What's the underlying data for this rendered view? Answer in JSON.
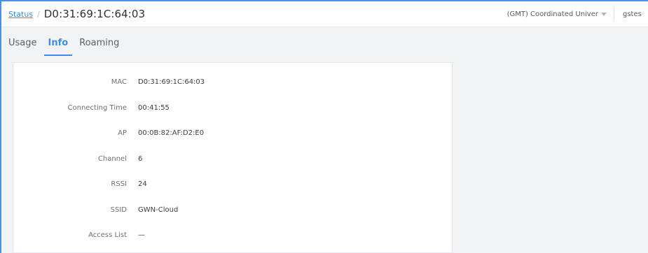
{
  "header": {
    "breadcrumb_link": "Status",
    "breadcrumb_sep": "/",
    "title": "D0:31:69:1C:64:03",
    "timezone": "(GMT) Coordinated Univer",
    "user": "gstes"
  },
  "tabs": [
    {
      "label": "Usage",
      "active": false
    },
    {
      "label": "Info",
      "active": true
    },
    {
      "label": "Roaming",
      "active": false
    }
  ],
  "info": {
    "rows": [
      {
        "label": "MAC",
        "value": "D0:31:69:1C:64:03"
      },
      {
        "label": "Connecting Time",
        "value": "00:41:55"
      },
      {
        "label": "AP",
        "value": "00:0B:82:AF:D2:E0"
      },
      {
        "label": "Channel",
        "value": "6"
      },
      {
        "label": "RSSI",
        "value": "24"
      },
      {
        "label": "SSID",
        "value": "GWN-Cloud"
      },
      {
        "label": "Access List",
        "value": "—"
      }
    ]
  },
  "colors": {
    "accent": "#3a8ee6",
    "frame_border": "#4a90e2",
    "background": "#f2f3f5"
  }
}
